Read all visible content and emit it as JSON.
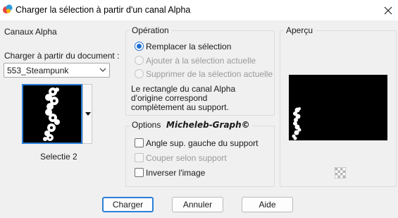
{
  "window": {
    "title": "Charger la sélection à partir d'un canal Alpha",
    "close_icon": "close-icon"
  },
  "channels": {
    "group_title": "Canaux Alpha",
    "load_from_label": "Charger à partir du document :",
    "document_value": "553_Steampunk",
    "selection_name": "Selectie 2"
  },
  "operation": {
    "group_title": "Opération",
    "options": [
      {
        "label": "Remplacer la sélection",
        "selected": true,
        "enabled": true
      },
      {
        "label": "Ajouter à la sélection actuelle",
        "selected": false,
        "enabled": false
      },
      {
        "label": "Supprimer de la sélection actuelle",
        "selected": false,
        "enabled": false
      }
    ],
    "info_lines": [
      "Le rectangle du canal Alpha",
      "d'origine correspond",
      "complètement au support."
    ]
  },
  "options": {
    "group_title": "Options",
    "watermark": "Micheleb-Graph©",
    "checkboxes": [
      {
        "label": "Angle sup. gauche du support",
        "checked": false,
        "enabled": true
      },
      {
        "label": "Couper selon support",
        "checked": false,
        "enabled": false
      },
      {
        "label": "Inverser l'image",
        "checked": false,
        "enabled": true
      }
    ]
  },
  "preview": {
    "group_title": "Aperçu",
    "transparency_icon": "checkerboard-icon"
  },
  "buttons": {
    "load": "Charger",
    "cancel": "Annuler",
    "help": "Aide"
  },
  "colors": {
    "accent": "#1f6fd1",
    "focus_border": "#2b7fd6",
    "canvas": "#000000"
  }
}
